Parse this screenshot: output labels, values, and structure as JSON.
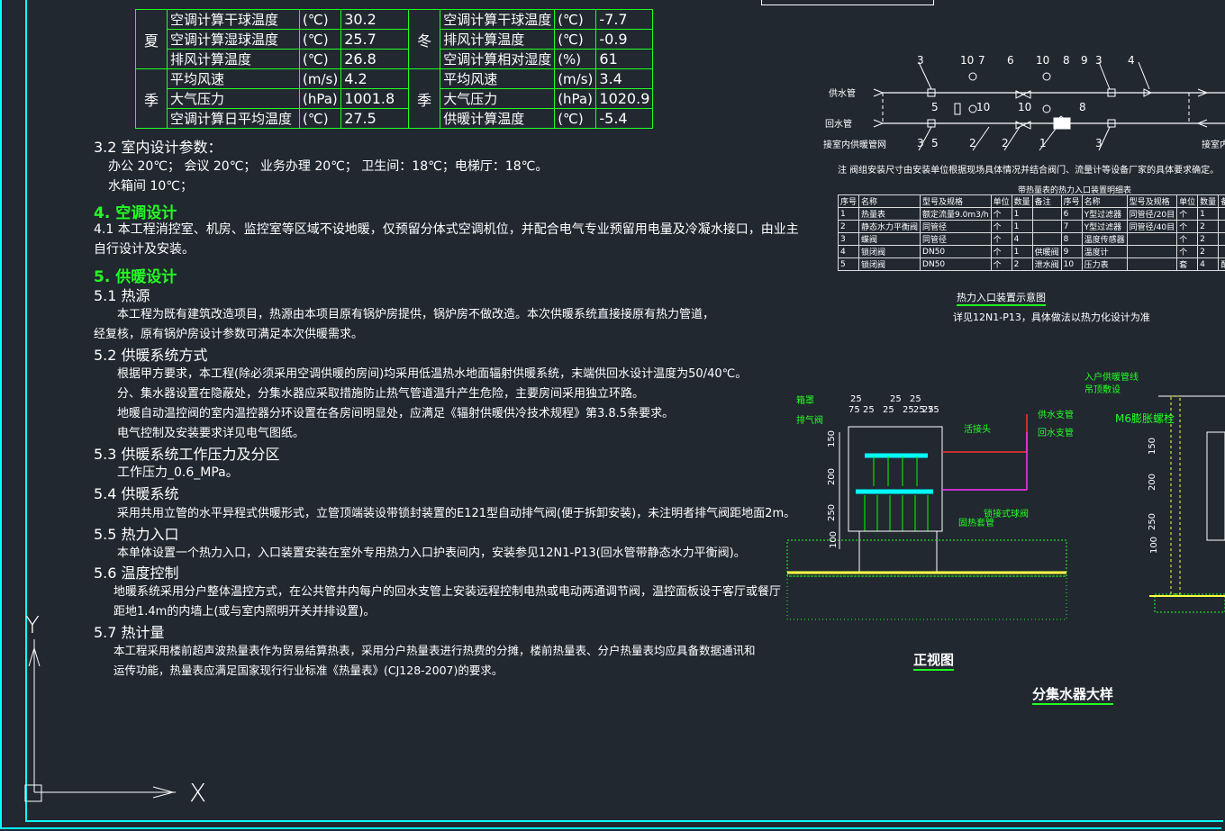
{
  "climate_table": {
    "summer_label": [
      "夏",
      "季"
    ],
    "winter_label": [
      "冬",
      "季"
    ],
    "rows": [
      {
        "s_name": "空调计算干球温度",
        "s_unit": "(℃)",
        "s_val": "30.2",
        "w_name": "空调计算干球温度",
        "w_unit": "(℃)",
        "w_val": "-7.7"
      },
      {
        "s_name": "空调计算湿球温度",
        "s_unit": "(℃)",
        "s_val": "25.7",
        "w_name": "排风计算温度",
        "w_unit": "(℃)",
        "w_val": "-0.9"
      },
      {
        "s_name": "排风计算温度",
        "s_unit": "(℃)",
        "s_val": "26.8",
        "w_name": "空调计算相对湿度",
        "w_unit": "(%)",
        "w_val": "61"
      },
      {
        "s_name": "平均风速",
        "s_unit": "(m/s)",
        "s_val": "4.2",
        "w_name": "平均风速",
        "w_unit": "(m/s)",
        "w_val": "3.4"
      },
      {
        "s_name": "大气压力",
        "s_unit": "(hPa)",
        "s_val": "1001.8",
        "w_name": "大气压力",
        "w_unit": "(hPa)",
        "w_val": "1020.9"
      },
      {
        "s_name": "空调计算日平均温度",
        "s_unit": "(℃)",
        "s_val": "27.5",
        "w_name": "供暖计算温度",
        "w_unit": "(℃)",
        "w_val": "-5.4"
      }
    ]
  },
  "notes": {
    "s32_title": "3.2  室内设计参数：",
    "s32_line1": "办公 20℃；  会议 20℃；  业务办理 20℃；  卫生间：18℃；电梯厅：18℃。",
    "s32_line2": "水箱间 10℃；",
    "s4_title": "4. 空调设计",
    "s41_line1": "4.1  本工程消控室、机房、监控室等区域不设地暖，仅预留分体式空调机位，并配合电气专业预留用电量及冷凝水接口，由业主",
    "s41_line2": "自行设计及安装。",
    "s5_title": "5. 供暖设计",
    "s51_title": "5.1   热源",
    "s51_line1": "本工程为既有建筑改造项目，热源由本项目原有锅炉房提供，锅炉房不做改造。本次供暖系统直接接原有热力管道，",
    "s51_line2": "经复核，原有锅炉房设计参数可满足本次供暖需求。",
    "s52_title": "5.2  供暖系统方式",
    "s52_line1": "根据甲方要求，本工程(除必须采用空调供暖的房间)均采用低温热水地面辐射供暖系统，末端供回水设计温度为50/40℃。",
    "s52_line2": "分、集水器设置在隐蔽处，分集水器应采取措施防止热气管道温升产生危险，主要房间采用独立环路。",
    "s52_line3": "地暖自动温控阀的室内温控器分环设置在各房间明显处，应满足《辐射供暖供冷技术规程》第3.8.5条要求。",
    "s52_line4": "电气控制及安装要求详见电气图纸。",
    "s53_title": "5.3  供暖系统工作压力及分区",
    "s53_line1": "工作压力_0.6_MPa。",
    "s54_title": "5.4   供暖系统",
    "s54_line1": "采用共用立管的水平异程式供暖形式，立管顶端装设带锁封装置的E121型自动排气阀(便于拆卸安装)，未注明者排气阀距地面2m。",
    "s55_title": "5.5   热力入口",
    "s55_line1": "本单体设置一个热力入口，入口装置安装在室外专用热力入口护表间内，安装参见12N1-P13(回水管带静态水力平衡阀)。",
    "s56_title": "5.6   温度控制",
    "s56_line1": "地暖系统采用分户整体温控方式，在公共管井内每户的回水支管上安装远程控制电热或电动两通调节阀，温控面板设于客厅或餐厅",
    "s56_line2": "距地1.4m的内墙上(或与室内照明开关并排设置)。",
    "s57_title": "5.7   热计量",
    "s57_line1": "本工程采用楼前超声波热量表作为贸易结算热表，采用分户热量表进行热费的分摊，楼前热量表、分户热量表均应具备数据通讯和",
    "s57_line2": "运传功能，热量表应满足国家现行行业标准《热量表》(CJ128-2007)的要求。"
  },
  "inlet_diagram": {
    "supply_label": "供水管",
    "return_label": "回水管",
    "indoor_label": "接室内供暖管网",
    "indoor_label_right": "接室内",
    "callouts_top": [
      "3",
      "10",
      "7",
      "6",
      "10",
      "8",
      "9",
      "3",
      "4"
    ],
    "callouts_bottom": [
      "3",
      "5",
      "2",
      "2",
      "1",
      "3"
    ],
    "callouts_mid": [
      "5",
      "10",
      "10",
      "8"
    ],
    "note": "注  阀组安装尺寸由安装单位根据现场具体情况并结合阀门、流量计等设备厂家的具体要求确定。"
  },
  "inlet_table": {
    "title": "带热量表的热力入口装置明细表",
    "headers": [
      "序号",
      "名称",
      "型号及规格",
      "单位",
      "数量",
      "备注",
      "序号",
      "名称",
      "型号及规格",
      "单位",
      "数量",
      "备"
    ],
    "rows": [
      [
        "1",
        "热量表",
        "额定流量9.0m3/h",
        "个",
        "1",
        "",
        "6",
        "Y型过滤器",
        "同管径/20目",
        "个",
        "1",
        ""
      ],
      [
        "2",
        "静态水力平衡阀",
        "同管径",
        "个",
        "1",
        "",
        "7",
        "Y型过滤器",
        "同管径/40目",
        "个",
        "2",
        ""
      ],
      [
        "3",
        "蝶阀",
        "同管径",
        "个",
        "4",
        "",
        "8",
        "温度传感器",
        "",
        "个",
        "2",
        ""
      ],
      [
        "4",
        "锁闭阀",
        "DN50",
        "个",
        "1",
        "供暖阀",
        "9",
        "温度计",
        "",
        "个",
        "2",
        ""
      ],
      [
        "5",
        "锁闭阀",
        "DN50",
        "个",
        "2",
        "泄水阀",
        "10",
        "压力表",
        "",
        "套",
        "4",
        "配套"
      ]
    ],
    "caption": "热力入口装置示意图",
    "caption_note": "详见12N1-P13，具体做法以热力化设计为准"
  },
  "manifold": {
    "label_cover": "箱罩",
    "label_vent": "排气阀",
    "label_joint": "活接头",
    "label_entry": "入户供暖管线",
    "label_entry2": "吊顶敷设",
    "label_supply": "供水支管",
    "label_return": "回水支管",
    "label_ball": "锁接式球阀",
    "label_sleeve": "固热套管",
    "label_bolt": "M6膨胀螺栓",
    "dims_top": [
      "75",
      "25",
      "25",
      "25",
      "25",
      "25",
      "75"
    ],
    "dims_top_upper": [
      "25",
      "25",
      "25"
    ],
    "dims_left": [
      "150",
      "200",
      "250",
      "100"
    ],
    "dims_right": [
      "150",
      "200",
      "250",
      "100"
    ],
    "view_title": "正视图",
    "detail_title": "分集水器大样"
  },
  "ucs": {
    "y_label": "Y",
    "x_label": "X"
  },
  "colors": {
    "background": "#212830",
    "frame": "#00ffff",
    "table_line": "#22ff22",
    "heading": "#22ff22",
    "accent_magenta": "#ff33ff",
    "accent_red": "#ff3333",
    "accent_yellow": "#ffff44"
  }
}
